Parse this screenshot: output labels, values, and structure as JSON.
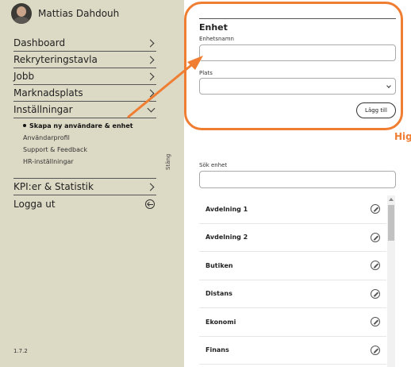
{
  "sidebar": {
    "user_name": "Mattias Dahdouh",
    "menu": [
      {
        "label": "Dashboard"
      },
      {
        "label": "Rekryteringstavla"
      },
      {
        "label": "Jobb"
      },
      {
        "label": "Marknadsplats"
      },
      {
        "label": "Inställningar"
      }
    ],
    "submenu": [
      {
        "label": "Skapa ny användare & enhet"
      },
      {
        "label": "Användarprofil"
      },
      {
        "label": "Support & Feedback"
      },
      {
        "label": "HR-inställningar"
      }
    ],
    "menu2": [
      {
        "label": "KPI:er & Statistik"
      },
      {
        "label": "Logga ut"
      }
    ],
    "close_label": "Stäng",
    "version": "1.7.2"
  },
  "form": {
    "title": "Enhet",
    "name_label": "Enhetsnamn",
    "name_value": "",
    "place_label": "Plats",
    "place_value": "",
    "add_button": "Lägg till"
  },
  "search": {
    "label": "Sök enhet",
    "value": ""
  },
  "units": [
    {
      "name": "Avdelning 1"
    },
    {
      "name": "Avdelning 2"
    },
    {
      "name": "Butiken"
    },
    {
      "name": "Distans"
    },
    {
      "name": "Ekonomi"
    },
    {
      "name": "Finans"
    }
  ],
  "overlay": {
    "corner_text": "Higl",
    "accent_color": "#ef7d32"
  }
}
